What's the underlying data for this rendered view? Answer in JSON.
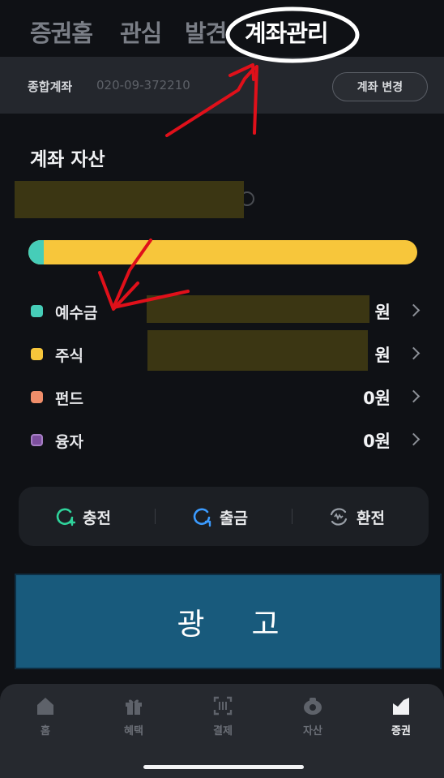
{
  "top_tabs": [
    {
      "label": "증권홈",
      "active": false
    },
    {
      "label": "관심",
      "active": false
    },
    {
      "label": "발견",
      "active": false
    },
    {
      "label": "계좌관리",
      "active": true
    }
  ],
  "account": {
    "name": "종합계좌",
    "number": "020-09-372210",
    "change_button": "계좌 변경"
  },
  "assets": {
    "title": "계좌 자산",
    "total_value": "",
    "bar": {
      "deposit_fraction": 0.04,
      "deposit_color": "#46cdb8",
      "stock_color": "#f7c63b"
    },
    "rows": [
      {
        "label": "예수금",
        "value": "원",
        "color": "#46cdb8",
        "value_redacted": true
      },
      {
        "label": "주식",
        "value": "원",
        "color": "#f7c63b",
        "value_redacted": true
      },
      {
        "label": "펀드",
        "value": "0원",
        "color": "#f08e6a",
        "value_redacted": false
      },
      {
        "label": "융자",
        "value": "0원",
        "color": "#7d4f9e",
        "value_redacted": false
      }
    ]
  },
  "actions": [
    {
      "label": "충전",
      "icon": "charge-icon",
      "color": "#2fd39b"
    },
    {
      "label": "출금",
      "icon": "withdraw-icon",
      "color": "#3b9bff"
    },
    {
      "label": "환전",
      "icon": "exchange-icon",
      "color": "#9aa0a8"
    }
  ],
  "ad": {
    "text": "광고"
  },
  "bottom_nav": [
    {
      "label": "홈",
      "icon": "home-icon",
      "active": false
    },
    {
      "label": "혜택",
      "icon": "gift-icon",
      "active": false
    },
    {
      "label": "결제",
      "icon": "scan-icon",
      "active": false
    },
    {
      "label": "자산",
      "icon": "wallet-icon",
      "active": false
    },
    {
      "label": "증권",
      "icon": "chart-icon",
      "active": true
    }
  ],
  "annotations": {
    "circle_color": "#ffffff",
    "arrow_color": "#e0101a"
  }
}
